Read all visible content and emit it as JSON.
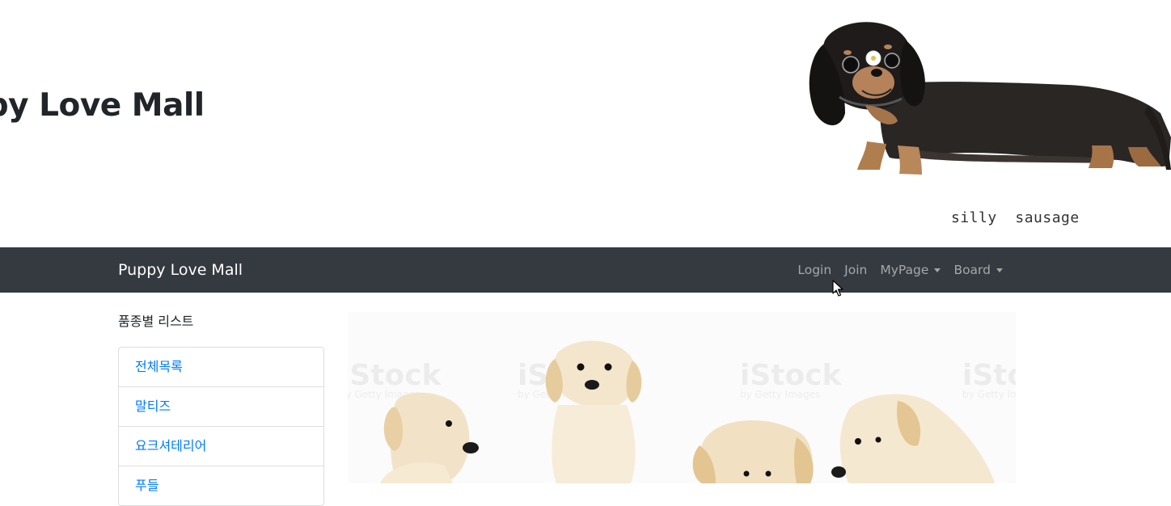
{
  "banner": {
    "site_title": "Puppy Love Mall",
    "dog_caption": "silly  sausage"
  },
  "navbar": {
    "brand": "Puppy Love Mall",
    "links": [
      {
        "label": "Login"
      },
      {
        "label": "Join"
      },
      {
        "label": "MyPage",
        "dropdown": true
      },
      {
        "label": "Board",
        "dropdown": true
      }
    ]
  },
  "sidebar": {
    "title": "품종별 리스트",
    "items": [
      {
        "label": "전체목록"
      },
      {
        "label": "말티즈"
      },
      {
        "label": "요크셔테리어"
      },
      {
        "label": "푸들"
      }
    ]
  },
  "hero": {
    "watermark": "iStock",
    "watermark_sub": "by Getty Images"
  },
  "colors": {
    "navbar_bg": "#343a40",
    "link_blue": "#007bff"
  }
}
